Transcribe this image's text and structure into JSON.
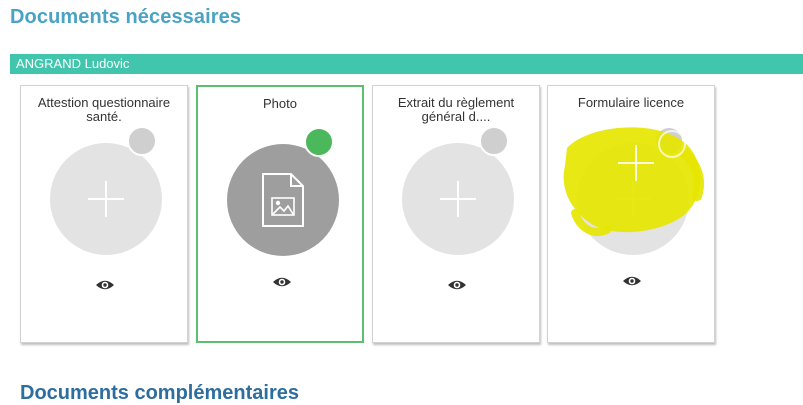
{
  "page": {
    "section_title": "Documents nécessaires",
    "next_section_title": "Documents complémentaires"
  },
  "person": {
    "name": "ANGRAND Ludovic"
  },
  "documents": [
    {
      "title": "Attestion questionnaire santé.",
      "state": "empty",
      "status": "pending",
      "icon": "plus-icon",
      "action_icon": "eye-icon"
    },
    {
      "title": "Photo",
      "state": "uploaded",
      "status": "ok",
      "icon": "image-file-icon",
      "action_icon": "eye-icon"
    },
    {
      "title": "Extrait du règlement général d....",
      "state": "empty",
      "status": "pending",
      "icon": "plus-icon",
      "action_icon": "eye-icon"
    },
    {
      "title": "Formulaire licence",
      "state": "empty",
      "status": "pending",
      "icon": "plus-icon",
      "action_icon": "eye-icon"
    }
  ],
  "colors": {
    "title": "#4aa3c4",
    "person_bar": "#41c6ad",
    "selected_border": "#5cbf6f",
    "status_ok": "#4cb85c",
    "status_pending": "#cfcfcf",
    "circle_empty": "#e3e3e3",
    "circle_filled": "#9e9e9e",
    "highlighter": "#e6e600"
  }
}
